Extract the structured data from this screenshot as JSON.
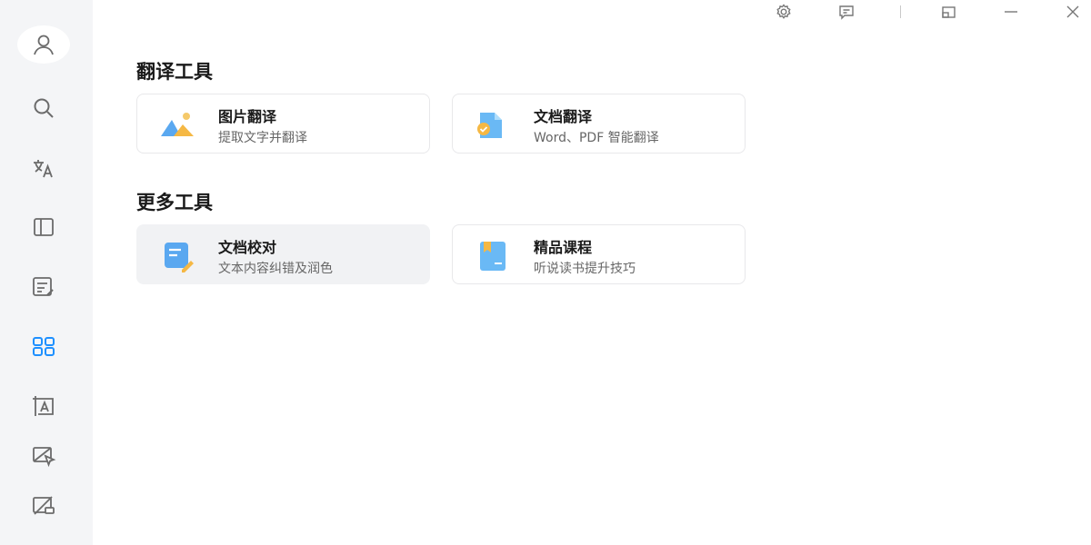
{
  "sidebar": {
    "items": [
      {
        "icon": "user-avatar-icon"
      },
      {
        "icon": "search-icon"
      },
      {
        "icon": "translate-icon"
      },
      {
        "icon": "book-icon"
      },
      {
        "icon": "note-edit-icon"
      },
      {
        "icon": "grid-apps-icon",
        "active": true
      },
      {
        "icon": "image-text-icon"
      },
      {
        "icon": "screenshot-translate-icon"
      },
      {
        "icon": "screen-off-icon"
      }
    ]
  },
  "titlebar": {
    "icons": [
      "gear-icon",
      "feedback-icon",
      "restore-icon",
      "minimize-icon",
      "close-icon"
    ]
  },
  "sections": [
    {
      "title": "翻译工具",
      "cards": [
        {
          "title": "图片翻译",
          "subtitle": "提取文字并翻译",
          "icon": "image-translate-icon"
        },
        {
          "title": "文档翻译",
          "subtitle": "Word、PDF 智能翻译",
          "icon": "document-translate-icon"
        }
      ]
    },
    {
      "title": "更多工具",
      "cards": [
        {
          "title": "文档校对",
          "subtitle": "文本内容纠错及润色",
          "icon": "proofread-icon",
          "active": true
        },
        {
          "title": "精品课程",
          "subtitle": "听说读书提升技巧",
          "icon": "course-icon"
        }
      ]
    }
  ],
  "colors": {
    "accent": "#1e90ff",
    "sidebar_bg": "#f4f5f7",
    "icon_gray": "#6b6b6b"
  }
}
